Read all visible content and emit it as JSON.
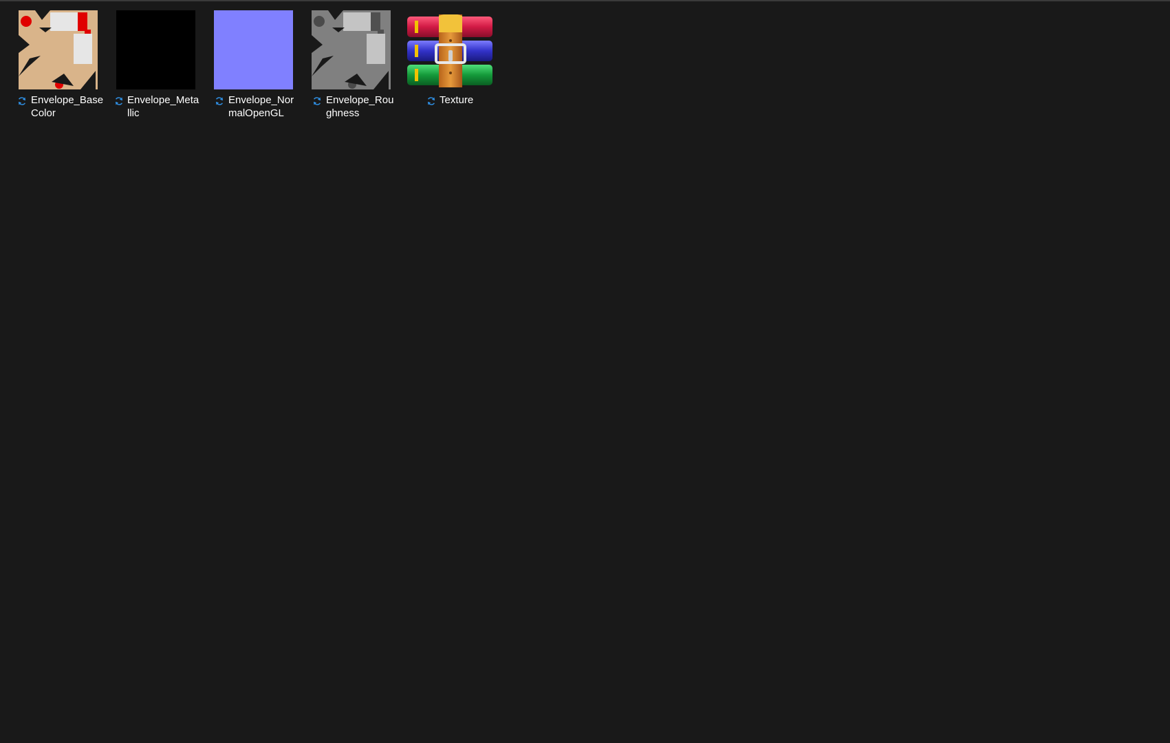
{
  "colors": {
    "background": "#191919",
    "sync_icon": "#2f8fe3",
    "label_text": "#ffffff"
  },
  "files": [
    {
      "label_line1": "Envelope_Base",
      "label_line2": "Color",
      "status_icon": "sync-pending-icon",
      "thumbnail": "base-color-texture-thumbnail"
    },
    {
      "label_line1": "Envelope_Meta",
      "label_line2": "llic",
      "status_icon": "sync-pending-icon",
      "thumbnail": "metallic-texture-thumbnail"
    },
    {
      "label_line1": "Envelope_Nor",
      "label_line2": "malOpenGL",
      "status_icon": "sync-pending-icon",
      "thumbnail": "normal-map-thumbnail"
    },
    {
      "label_line1": "Envelope_Rou",
      "label_line2": "ghness",
      "status_icon": "sync-pending-icon",
      "thumbnail": "roughness-texture-thumbnail"
    },
    {
      "label_line1": "Texture",
      "label_line2": "",
      "status_icon": "sync-pending-icon",
      "thumbnail": "winrar-archive-icon"
    }
  ]
}
